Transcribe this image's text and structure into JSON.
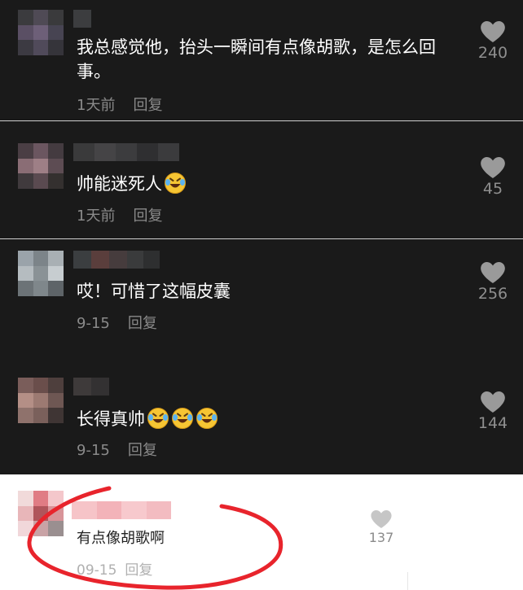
{
  "comments": [
    {
      "text": "我总感觉他，抬头一瞬间有点像胡歌，是怎么回事。",
      "time": "1天前",
      "reply": "回复",
      "likes": "240"
    },
    {
      "text": "帅能迷死人",
      "time": "1天前",
      "reply": "回复",
      "likes": "45"
    },
    {
      "text": "哎！可惜了这幅皮囊",
      "time": "9-15",
      "reply": "回复",
      "likes": "256"
    },
    {
      "text": "长得真帅",
      "time": "9-15",
      "reply": "回复",
      "likes": "144"
    },
    {
      "text": "有点像胡歌啊",
      "time": "09-15",
      "reply": "回复",
      "likes": "137"
    }
  ],
  "icons": {
    "like": "heart-icon",
    "emoji": "laughing-tears-emoji"
  },
  "colors": {
    "dark_bg": "#1a1a1a",
    "light_bg": "#ffffff",
    "annotation": "#e8242c"
  }
}
